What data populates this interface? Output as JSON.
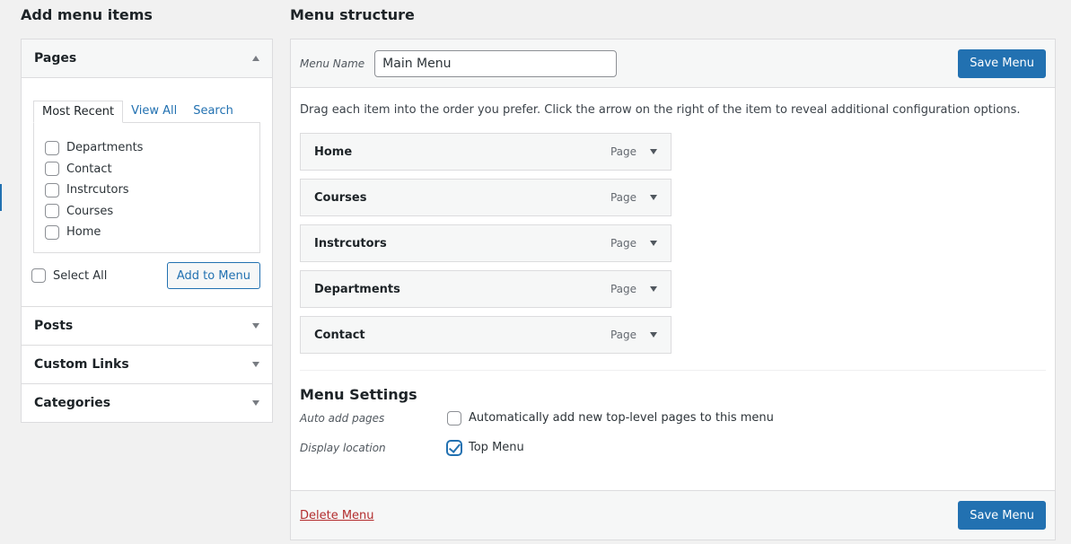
{
  "left": {
    "title": "Add menu items",
    "sections": {
      "pages": {
        "label": "Pages",
        "tabs": [
          "Most Recent",
          "View All",
          "Search"
        ],
        "items": [
          "Departments",
          "Contact",
          "Instrcutors",
          "Courses",
          "Home"
        ],
        "select_all": "Select All",
        "add_button": "Add to Menu"
      },
      "posts": {
        "label": "Posts"
      },
      "custom_links": {
        "label": "Custom Links"
      },
      "categories": {
        "label": "Categories"
      }
    }
  },
  "right": {
    "title": "Menu structure",
    "menu_name_label": "Menu Name",
    "menu_name_value": "Main Menu",
    "save_label": "Save Menu",
    "instructions": "Drag each item into the order you prefer. Click the arrow on the right of the item to reveal additional configuration options.",
    "items": [
      {
        "title": "Home",
        "type": "Page"
      },
      {
        "title": "Courses",
        "type": "Page"
      },
      {
        "title": "Instrcutors",
        "type": "Page"
      },
      {
        "title": "Departments",
        "type": "Page"
      },
      {
        "title": "Contact",
        "type": "Page"
      }
    ],
    "settings": {
      "title": "Menu Settings",
      "auto_add_label": "Auto add pages",
      "auto_add_text": "Automatically add new top-level pages to this menu",
      "auto_add_checked": false,
      "location_label": "Display location",
      "location_text": "Top Menu",
      "location_checked": true
    },
    "delete_label": "Delete Menu"
  },
  "colors": {
    "accent": "#2271b1",
    "delete": "#b32d2e",
    "background": "#f1f1f1"
  }
}
